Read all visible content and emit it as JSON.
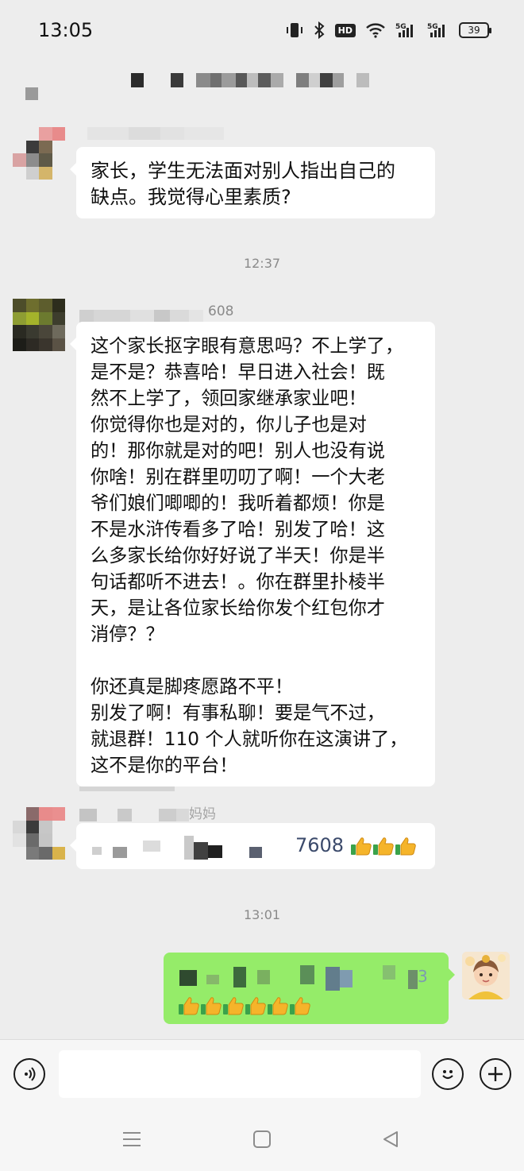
{
  "status_bar": {
    "time": "13:05",
    "icons": [
      "vibrate-icon",
      "bluetooth-icon",
      "hd-icon",
      "wifi-icon",
      "signal-5g-icon",
      "signal-5g-icon"
    ],
    "hd_label": "HD",
    "battery_level": "39"
  },
  "chat": {
    "messages": [
      {
        "side": "left",
        "text": "家长，学生无法面对别人指出自己的\n缺点。我觉得心里素质?"
      },
      {
        "type": "time",
        "text": "12:37"
      },
      {
        "side": "left",
        "name_suffix": "608",
        "text": "这个家长抠字眼有意思吗？不上学了，\n是不是？恭喜哈！早日进入社会！既\n然不上学了，领回家继承家业吧！\n你觉得你也是对的，你儿子也是对\n的！那你就是对的吧！别人也没有说\n你啥！别在群里叨叨了啊！一个大老\n爷们娘们唧唧的！我听着都烦！你是\n不是水浒传看多了哈！别发了哈！这\n么多家长给你好好说了半天！你是半\n句话都听不进去！。你在群里扑棱半\n天，是让各位家长给你发个红包你才\n消停？？\n\n你还真是脚疼愿路不平！\n别发了啊！有事私聊！要是气不过，\n就退群！110 个人就听你在这演讲了，\n这不是你的平台！"
      },
      {
        "side": "left",
        "name_suffix": "妈妈",
        "text": "7608"
      },
      {
        "type": "time",
        "text": "13:01"
      },
      {
        "side": "right",
        "text_suffix": "3"
      }
    ]
  },
  "input_bar": {
    "voice_icon": "voice-icon",
    "emoji_icon": "emoji-icon",
    "plus_icon": "plus-icon",
    "placeholder": ""
  },
  "nav_bar": {
    "icons": [
      "menu-icon",
      "home-icon",
      "back-icon"
    ]
  },
  "colors": {
    "background": "#ededed",
    "bubble_left": "#ffffff",
    "bubble_right": "#95ec69",
    "time_text": "#8a8a8a"
  }
}
